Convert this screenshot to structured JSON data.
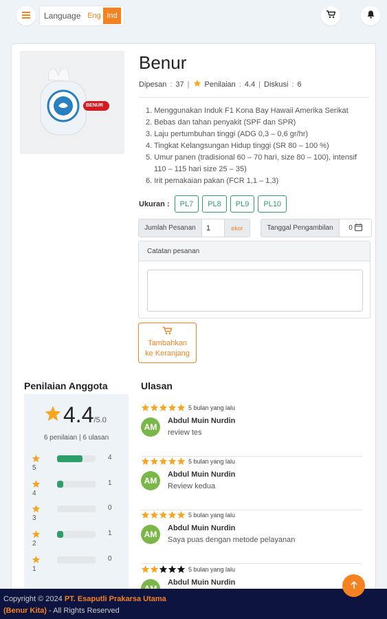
{
  "header": {
    "language_label": "Language",
    "languages": [
      "Eng",
      "Ind"
    ],
    "active_language": "Ind",
    "menu_icon": "menu-icon",
    "cart_icon": "cart-icon",
    "bell_icon": "bell-icon"
  },
  "product": {
    "title": "Benur",
    "image_badge": "BENUR",
    "ordered_label": "Dipesan",
    "ordered_value": "37",
    "rating_label": "Penilaian",
    "rating_value": "4.4",
    "discussion_label": "Diskusi",
    "discussion_value": "6",
    "features": [
      "1. Menggunakan Induk F1 Kona Bay Hawaii Amerika Serikat",
      "2. Bebas dan tahan penyakit (SPF dan SPR)",
      "3. Laju pertumbuhan tinggi (ADG 0,3 – 0,6 gr/hr)",
      "4. Tingkat Kelangsungan Hidup tinggi (SR 80 – 100 %)",
      "5. Umur panen (tradisional 60 – 70 hari, size 80 – 100), intensif 110 – 115 hari size 25 – 35)",
      "6. Irit pemakaian pakan (FCR 1,1 – 1,3)"
    ],
    "size_label": "Ukuran :",
    "sizes": [
      "PL7",
      "PL8",
      "PL9",
      "PL10"
    ]
  },
  "order_form": {
    "quantity_label": "Jumlah Pesanan",
    "quantity_value": "1",
    "quantity_unit": "ekor",
    "pickup_label": "Tanggal Pengambilan",
    "pickup_value": "0",
    "notes_label": "Catatan pesanan",
    "notes_value": "",
    "add_to_cart_line1": "Tambahkan",
    "add_to_cart_line2": "ke Keranjang"
  },
  "rating_summary": {
    "title": "Penilaian Anggota",
    "average": "4.4",
    "out_of": "/5.0",
    "summary": "6 penilaian | 6 ulasan",
    "bars": [
      {
        "level": "5",
        "count": "4",
        "fraction": 0.667
      },
      {
        "level": "4",
        "count": "1",
        "fraction": 0.167
      },
      {
        "level": "3",
        "count": "0",
        "fraction": 0
      },
      {
        "level": "2",
        "count": "1",
        "fraction": 0.167
      },
      {
        "level": "1",
        "count": "0",
        "fraction": 0
      }
    ]
  },
  "reviews": {
    "title": "Ulasan",
    "items": [
      {
        "stars": 5,
        "time": "5 bulan yang lalu",
        "initials": "AM",
        "name": "Abdul Muin Nurdin",
        "text": "review tes"
      },
      {
        "stars": 5,
        "time": "5 bulan yang lalu",
        "initials": "AM",
        "name": "Abdul Muin Nurdin",
        "text": "Review kedua"
      },
      {
        "stars": 5,
        "time": "5 bulan yang lalu",
        "initials": "AM",
        "name": "Abdul Muin Nurdin",
        "text": "Saya puas dengan metode pelayanan"
      },
      {
        "stars": 2,
        "time": "5 bulan yang lalu",
        "initials": "AM",
        "name": "Abdul Muin Nurdin",
        "text": ""
      }
    ]
  },
  "footer": {
    "prefix": "Copyright © 2024 ",
    "company": "PT. Esaputli Prakarsa Utama",
    "brand": "(Benur Kita)",
    "suffix": " - All Rights Reserved"
  },
  "colors": {
    "accent": "#f58220",
    "green": "#2e9e6a",
    "navy": "#0d1440",
    "avatar": "#7ab648",
    "star_filled": "#f5a623",
    "star_empty": "#111111"
  }
}
